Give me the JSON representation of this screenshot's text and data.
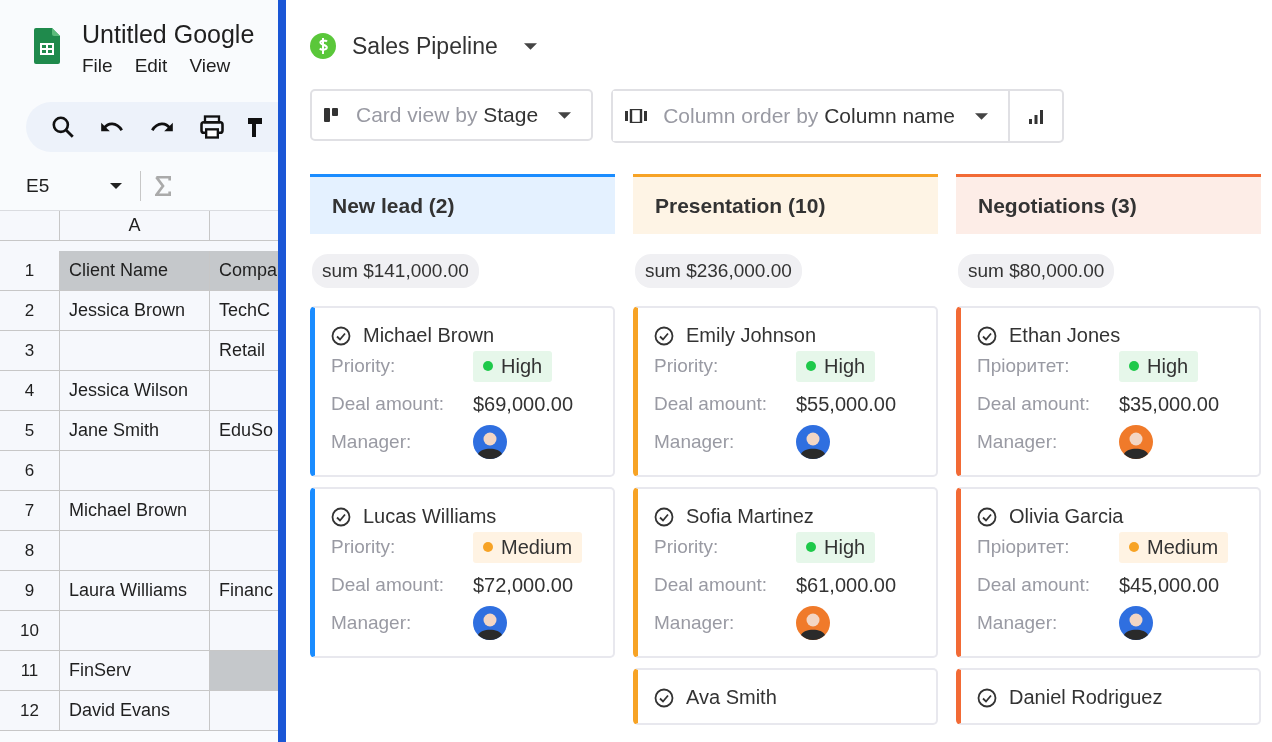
{
  "sheet": {
    "title": "Untitled Google",
    "menu": [
      "File",
      "Edit",
      "View"
    ],
    "name_box": "E5",
    "columns": [
      "A"
    ],
    "rows": [
      {
        "number": "1",
        "cells": [
          {
            "text": "Client Name",
            "shaded": true
          },
          {
            "text": "Compa",
            "shaded": true
          }
        ]
      },
      {
        "number": "2",
        "cells": [
          {
            "text": "Jessica Brown",
            "shaded": false
          },
          {
            "text": "TechC",
            "shaded": false
          }
        ]
      },
      {
        "number": "3",
        "cells": [
          {
            "shaded": false
          },
          {
            "text": "Retail",
            "shaded": false
          }
        ]
      },
      {
        "number": "4",
        "cells": [
          {
            "text": "Jessica Wilson",
            "shaded": false
          },
          {
            "shaded": false
          }
        ]
      },
      {
        "number": "5",
        "cells": [
          {
            "text": "Jane Smith",
            "shaded": false
          },
          {
            "text": "EduSo",
            "shaded": false
          }
        ]
      },
      {
        "number": "6",
        "cells": [
          {
            "shaded": false
          },
          {
            "shaded": false
          }
        ]
      },
      {
        "number": "7",
        "cells": [
          {
            "text": "Michael Brown",
            "shaded": false
          },
          {
            "shaded": false
          }
        ]
      },
      {
        "number": "8",
        "cells": [
          {
            "shaded": false
          },
          {
            "shaded": false
          }
        ]
      },
      {
        "number": "9",
        "cells": [
          {
            "text": "Laura Williams",
            "shaded": false
          },
          {
            "text": "Financ",
            "shaded": false
          }
        ]
      },
      {
        "number": "10",
        "cells": [
          {
            "shaded": false
          },
          {
            "shaded": false
          }
        ]
      },
      {
        "number": "11",
        "cells": [
          {
            "text": "FinServ",
            "shaded": false
          },
          {
            "shaded": true
          }
        ]
      },
      {
        "number": "12",
        "cells": [
          {
            "text": "David Evans",
            "shaded": false
          },
          {
            "shaded": false
          }
        ]
      }
    ]
  },
  "pipeline": {
    "title": "Sales Pipeline",
    "card_view": {
      "label": "Card view by",
      "value": "Stage"
    },
    "column_order": {
      "label": "Column order by",
      "value": "Column name"
    },
    "columns": [
      {
        "title": "New lead (2)",
        "color": "#1a8cff",
        "sum": "sum $141,000.00",
        "cards": [
          {
            "name": "Michael Brown",
            "fields": [
              {
                "label": "Priority:",
                "value": "High",
                "kind": "high"
              },
              {
                "label": "Deal amount:",
                "value": "$69,000.00",
                "kind": "text"
              },
              {
                "label": "Manager:",
                "kind": "avatar",
                "color": "#2f6fe0"
              }
            ]
          },
          {
            "name": "Lucas Williams",
            "fields": [
              {
                "label": "Priority:",
                "value": "Medium",
                "kind": "medium"
              },
              {
                "label": "Deal amount:",
                "value": "$72,000.00",
                "kind": "text"
              },
              {
                "label": "Manager:",
                "kind": "avatar",
                "color": "#2f6fe0"
              }
            ]
          }
        ]
      },
      {
        "title": "Presentation (10)",
        "color": "#f7a325",
        "sum": "sum $236,000.00",
        "cards": [
          {
            "name": "Emily Johnson",
            "fields": [
              {
                "label": "Priority:",
                "value": "High",
                "kind": "high"
              },
              {
                "label": "Deal amount:",
                "value": "$55,000.00",
                "kind": "text"
              },
              {
                "label": "Manager:",
                "kind": "avatar",
                "color": "#2f6fe0"
              }
            ]
          },
          {
            "name": "Sofia Martinez",
            "fields": [
              {
                "label": "Priority:",
                "value": "High",
                "kind": "high"
              },
              {
                "label": "Deal amount:",
                "value": "$61,000.00",
                "kind": "text"
              },
              {
                "label": "Manager:",
                "kind": "avatar",
                "color": "#f07a2a"
              }
            ]
          },
          {
            "name": "Ava Smith"
          }
        ]
      },
      {
        "title": "Negotiations (3)",
        "color": "#f26a35",
        "sum": "sum $80,000.00",
        "cards": [
          {
            "name": "Ethan Jones",
            "fields": [
              {
                "label": "Пріоритет:",
                "value": "High",
                "kind": "high"
              },
              {
                "label": "Deal amount:",
                "value": "$35,000.00",
                "kind": "text"
              },
              {
                "label": "Manager:",
                "kind": "avatar",
                "color": "#f07a2a"
              }
            ]
          },
          {
            "name": "Olivia Garcia",
            "fields": [
              {
                "label": "Пріоритет:",
                "value": "Medium",
                "kind": "medium"
              },
              {
                "label": "Deal amount:",
                "value": "$45,000.00",
                "kind": "text"
              },
              {
                "label": "Manager:",
                "kind": "avatar",
                "color": "#2f6fe0"
              }
            ]
          },
          {
            "name": "Daniel Rodriguez"
          }
        ]
      }
    ]
  }
}
